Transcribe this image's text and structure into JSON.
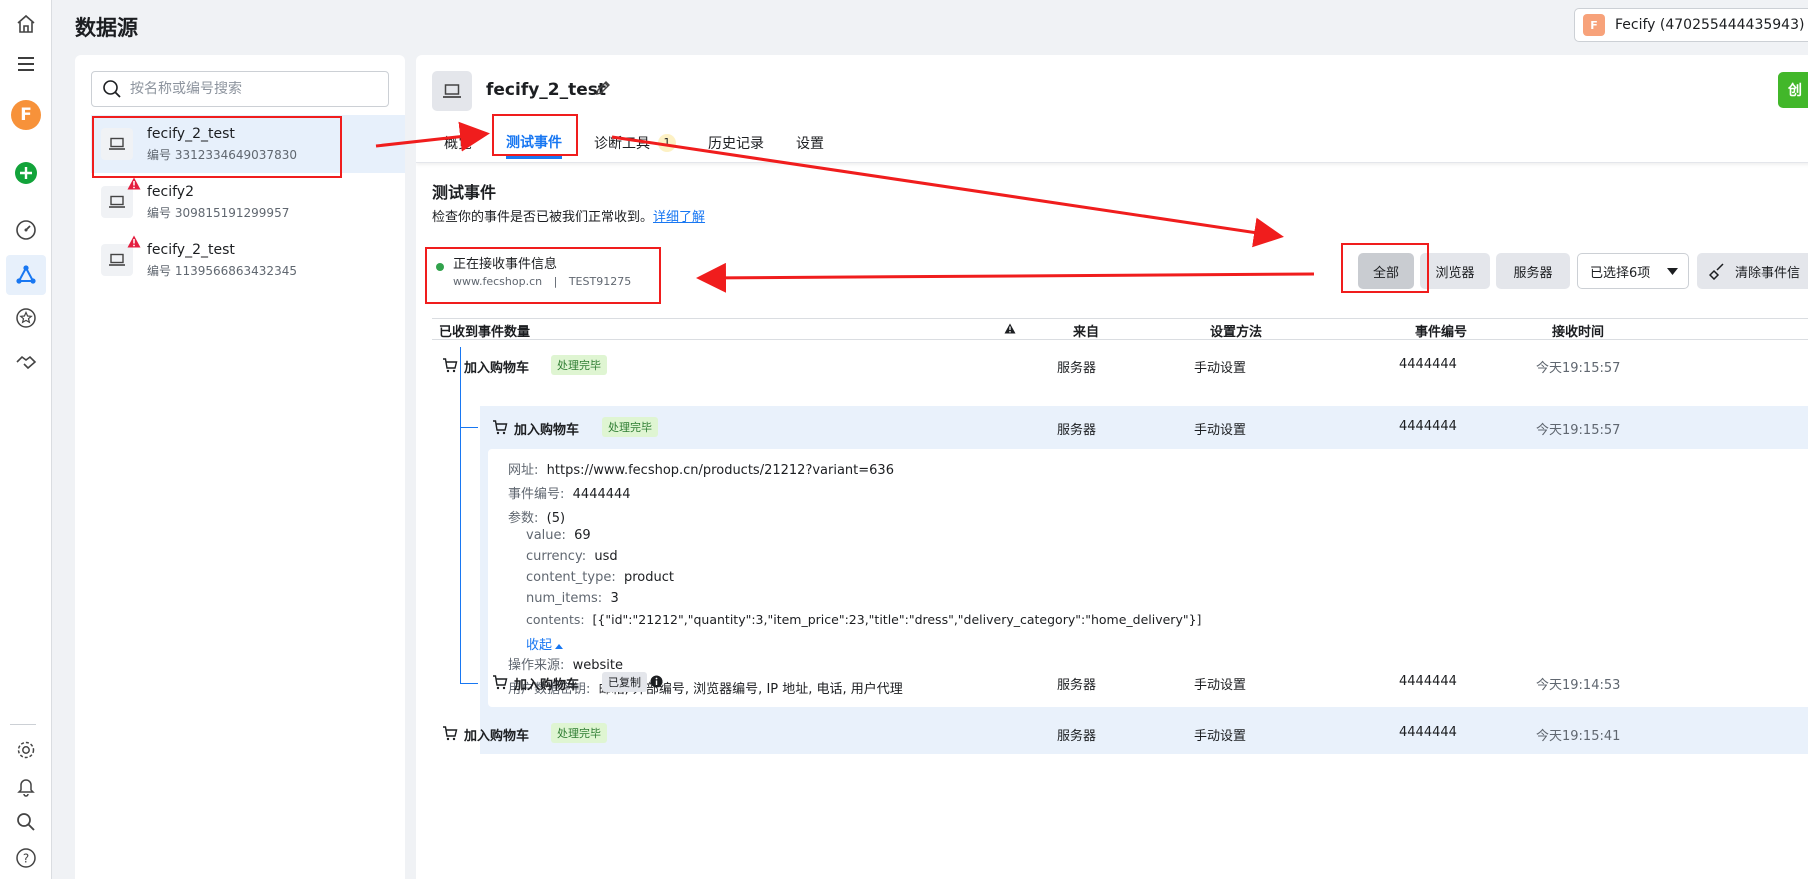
{
  "page": {
    "title": "数据源"
  },
  "account": {
    "avatar": "F",
    "label": "Fecify (470255444435943)"
  },
  "rail": {
    "avatar": "F",
    "icons": [
      "home-icon",
      "menu-icon",
      "avatar",
      "add-icon",
      "dashboard-icon",
      "graph-icon",
      "star-icon",
      "handshake-icon",
      "gear-icon",
      "bell-icon",
      "search-icon",
      "help-icon"
    ]
  },
  "search": {
    "placeholder": "按名称或编号搜索"
  },
  "sources": [
    {
      "name": "fecify_2_test",
      "id": "编号 3312334649037830",
      "warning": false
    },
    {
      "name": "fecify2",
      "id": "编号 309815191299957",
      "warning": true
    },
    {
      "name": "fecify_2_test",
      "id": "编号 1139566863432345",
      "warning": true
    }
  ],
  "detail": {
    "title": "fecify_2_test",
    "create_label": "创",
    "tabs": [
      {
        "label": "概览"
      },
      {
        "label": "测试事件"
      },
      {
        "label": "诊断工具",
        "count": "1"
      },
      {
        "label": "历史记录"
      },
      {
        "label": "设置"
      }
    ],
    "section_title": "测试事件",
    "section_desc": "检查你的事件是否已被我们正常收到。",
    "learn_more": "详细了解",
    "status": {
      "title": "正在接收事件信息",
      "site": "www.fecshop.cn",
      "sep": "|",
      "code": "TEST91275"
    },
    "filters": {
      "all": "全部",
      "browser": "浏览器",
      "server": "服务器",
      "selected": "已选择6项",
      "clear": "清除事件信"
    }
  },
  "table": {
    "headers": {
      "count": "已收到事件数量",
      "from": "来自",
      "method": "设置方法",
      "event_id": "事件编号",
      "time": "接收时间"
    },
    "rows": [
      {
        "name": "加入购物车",
        "badge": "处理完毕",
        "from": "服务器",
        "method": "手动设置",
        "event_id": "4444444",
        "time": "今天19:15:57"
      },
      {
        "name": "加入购物车",
        "badge": "处理完毕",
        "from": "服务器",
        "method": "手动设置",
        "event_id": "4444444",
        "time": "今天19:15:57"
      },
      {
        "name": "加入购物车",
        "badge": "已复制",
        "from": "服务器",
        "method": "手动设置",
        "event_id": "4444444",
        "time": "今天19:14:53"
      },
      {
        "name": "加入购物车",
        "badge": "处理完毕",
        "from": "服务器",
        "method": "手动设置",
        "event_id": "4444444",
        "time": "今天19:15:41"
      }
    ],
    "expanded": {
      "url_k": "网址:",
      "url_v": "https://www.fecshop.cn/products/21212?variant=636",
      "eid_k": "事件编号:",
      "eid_v": "4444444",
      "params_k": "参数:",
      "params_v": "(5)",
      "params": [
        {
          "k": "value:",
          "v": "69"
        },
        {
          "k": "currency:",
          "v": "usd"
        },
        {
          "k": "content_type:",
          "v": "product"
        },
        {
          "k": "num_items:",
          "v": "3"
        },
        {
          "k": "contents:",
          "v": "[{\"id\":\"21212\",\"quantity\":3,\"item_price\":23,\"title\":\"dress\",\"delivery_category\":\"home_delivery\"}]"
        }
      ],
      "collapse": "收起",
      "source_k": "操作来源:",
      "source_v": "website",
      "keys_k": "用户数据密钥:",
      "keys_v": "邮箱, 外部编号, 浏览器编号, IP 地址, 电话, 用户代理"
    }
  }
}
